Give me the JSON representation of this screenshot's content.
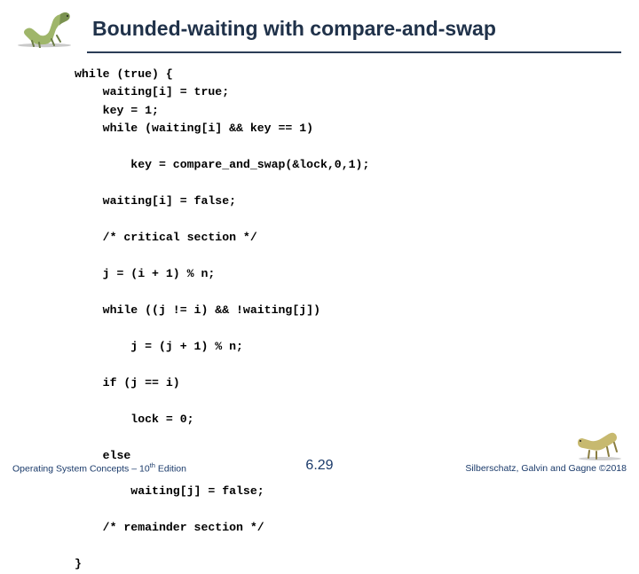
{
  "header": {
    "title": "Bounded-waiting with compare-and-swap"
  },
  "code": {
    "lines": [
      "while (true) {",
      "    waiting[i] = true;",
      "    key = 1;",
      "    while (waiting[i] && key == 1)",
      "        key = compare_and_swap(&lock,0,1);",
      "    waiting[i] = false;",
      "    /* critical section */",
      "    j = (i + 1) % n;",
      "    while ((j != i) && !waiting[j])",
      "        j = (j + 1) % n;",
      "    if (j == i)",
      "        lock = 0;",
      "    else",
      "        waiting[j] = false;",
      "    /* remainder section */",
      "}"
    ]
  },
  "footer": {
    "left_prefix": "Operating System Concepts – 10",
    "left_super": "th",
    "left_suffix": " Edition",
    "center": "6.29",
    "right": "Silberschatz, Galvin and Gagne ©2018"
  }
}
